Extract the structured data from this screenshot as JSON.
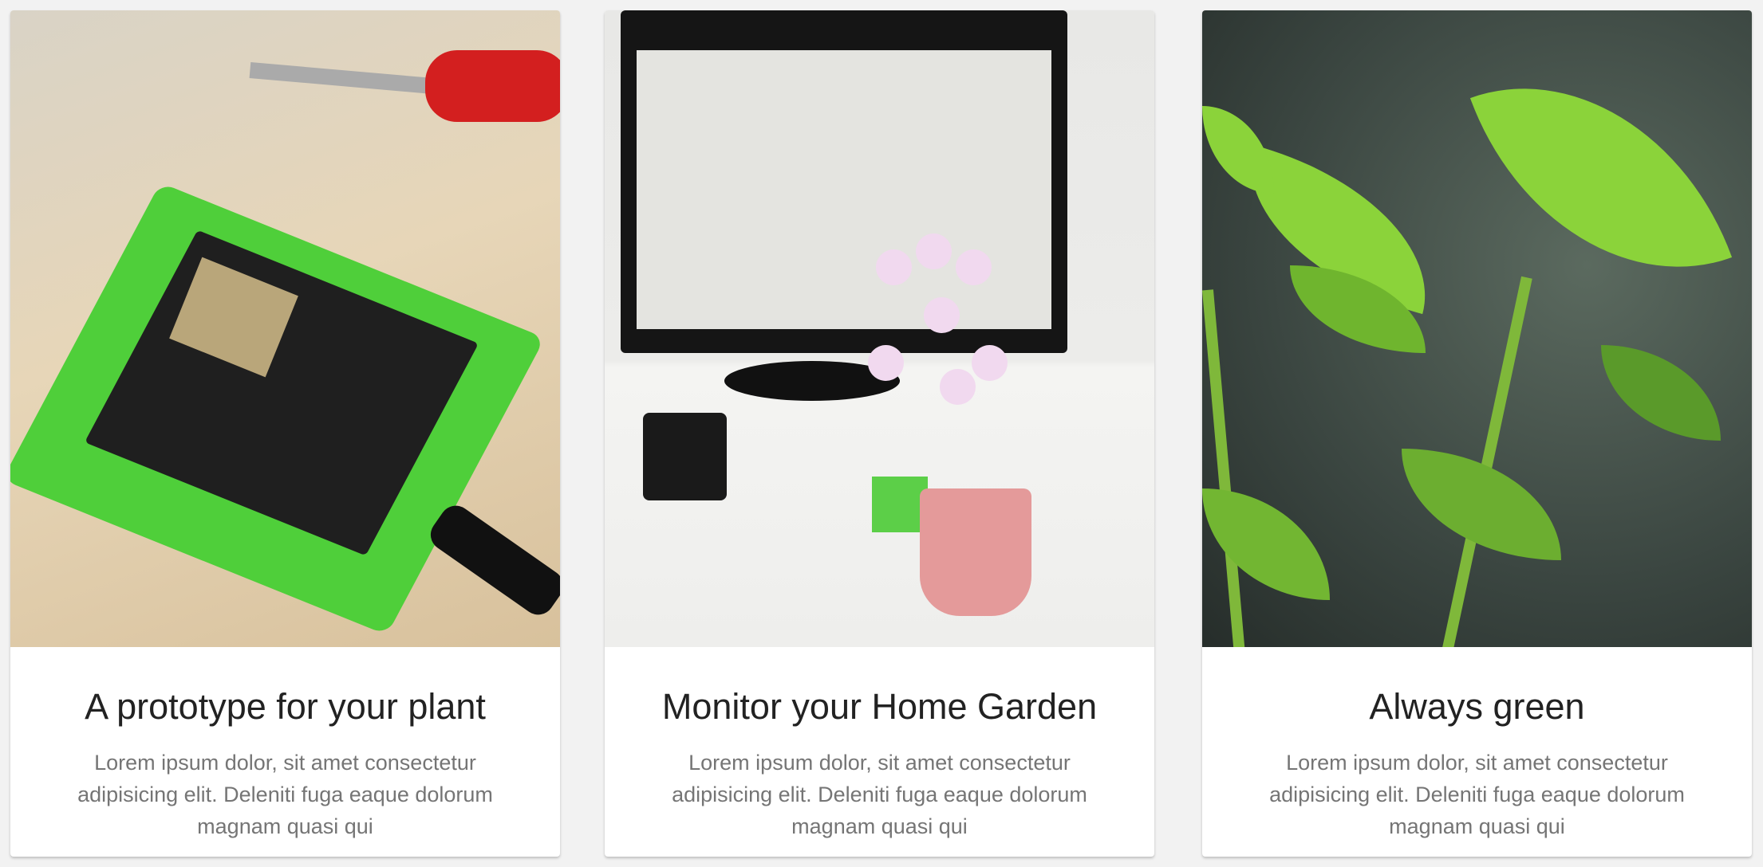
{
  "cards": [
    {
      "title": "A prototype for your plant",
      "text": "Lorem ipsum dolor, sit amet consectetur adipisicing elit. Deleniti fuga eaque dolorum magnam quasi qui"
    },
    {
      "title": "Monitor your Home Garden",
      "text": "Lorem ipsum dolor, sit amet consectetur adipisicing elit. Deleniti fuga eaque dolorum magnam quasi qui"
    },
    {
      "title": "Always green",
      "text": "Lorem ipsum dolor, sit amet consectetur adipisicing elit. Deleniti fuga eaque dolorum magnam quasi qui"
    }
  ]
}
